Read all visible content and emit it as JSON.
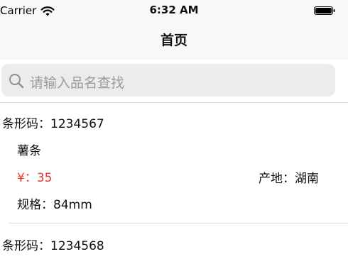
{
  "status_bar": {
    "carrier": "Carrier",
    "time": "6:32 AM"
  },
  "nav": {
    "title": "首页"
  },
  "search": {
    "placeholder": "请输入品名查找"
  },
  "items": [
    {
      "barcode": "条形码：1234567",
      "name": "薯条",
      "price": "¥：35",
      "origin": "产地：湖南",
      "spec": "规格：84mm"
    },
    {
      "barcode": "条形码：1234568"
    }
  ],
  "colors": {
    "price": "#e8372e",
    "search_bg": "#ececee",
    "nav_bg": "#f8f8f8"
  }
}
